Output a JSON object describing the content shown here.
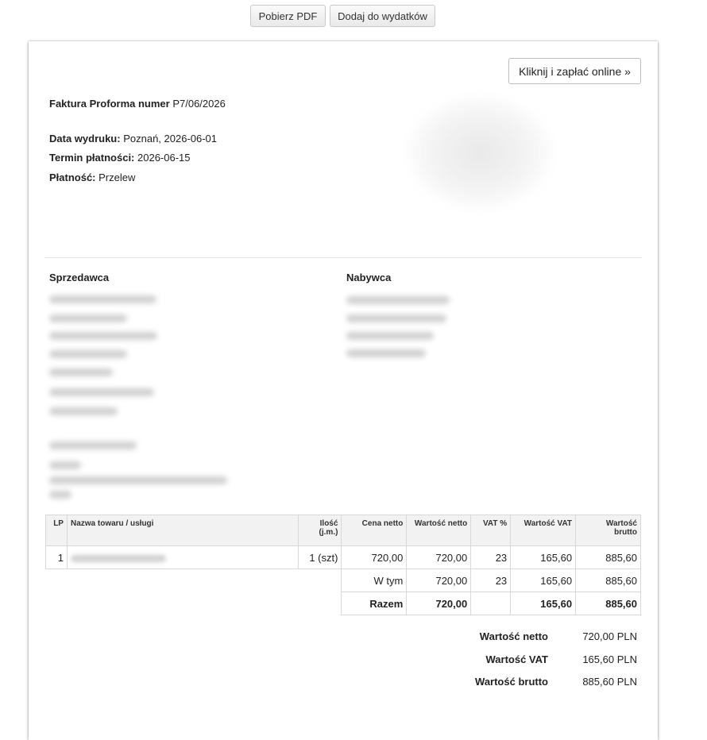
{
  "toolbar": {
    "pdf_label": "Pobierz PDF",
    "add_label": "Dodaj do wydatków"
  },
  "invoice": {
    "pay_online_label": "Kliknij i zapłać online »",
    "title_label": "Faktura Proforma numer",
    "number": "P7/06/2026",
    "print_date_label": "Data wydruku:",
    "print_date_value": "Poznań, 2026-06-01",
    "due_label": "Termin płatności:",
    "due_value": "2026-06-15",
    "payment_label": "Płatność:",
    "payment_value": "Przelew",
    "seller_title": "Sprzedawca",
    "buyer_title": "Nabywca"
  },
  "table": {
    "headers": {
      "lp": "LP",
      "name": "Nazwa towaru / usługi",
      "qty_line1": "Ilość",
      "qty_line2": "(j.m.)",
      "net_price": "Cena netto",
      "net_value": "Wartość netto",
      "vat_rate": "VAT %",
      "vat_value": "Wartość VAT",
      "gross_line1": "Wartość",
      "gross_line2": "brutto"
    },
    "rows": [
      {
        "lp": "1",
        "qty": "1 (szt)",
        "net_price": "720,00",
        "net_value": "720,00",
        "vat_rate": "23",
        "vat_value": "165,60",
        "gross": "885,60"
      }
    ],
    "subtotal": {
      "label": "W tym",
      "net_value": "720,00",
      "vat_rate": "23",
      "vat_value": "165,60",
      "gross": "885,60"
    },
    "total": {
      "label": "Razem",
      "net_value": "720,00",
      "vat_value": "165,60",
      "gross": "885,60"
    }
  },
  "summary": {
    "net_label": "Wartość netto",
    "net_value": "720,00 PLN",
    "vat_label": "Wartość VAT",
    "vat_value": "165,60 PLN",
    "gross_label": "Wartość brutto",
    "gross_value": "885,60 PLN"
  }
}
